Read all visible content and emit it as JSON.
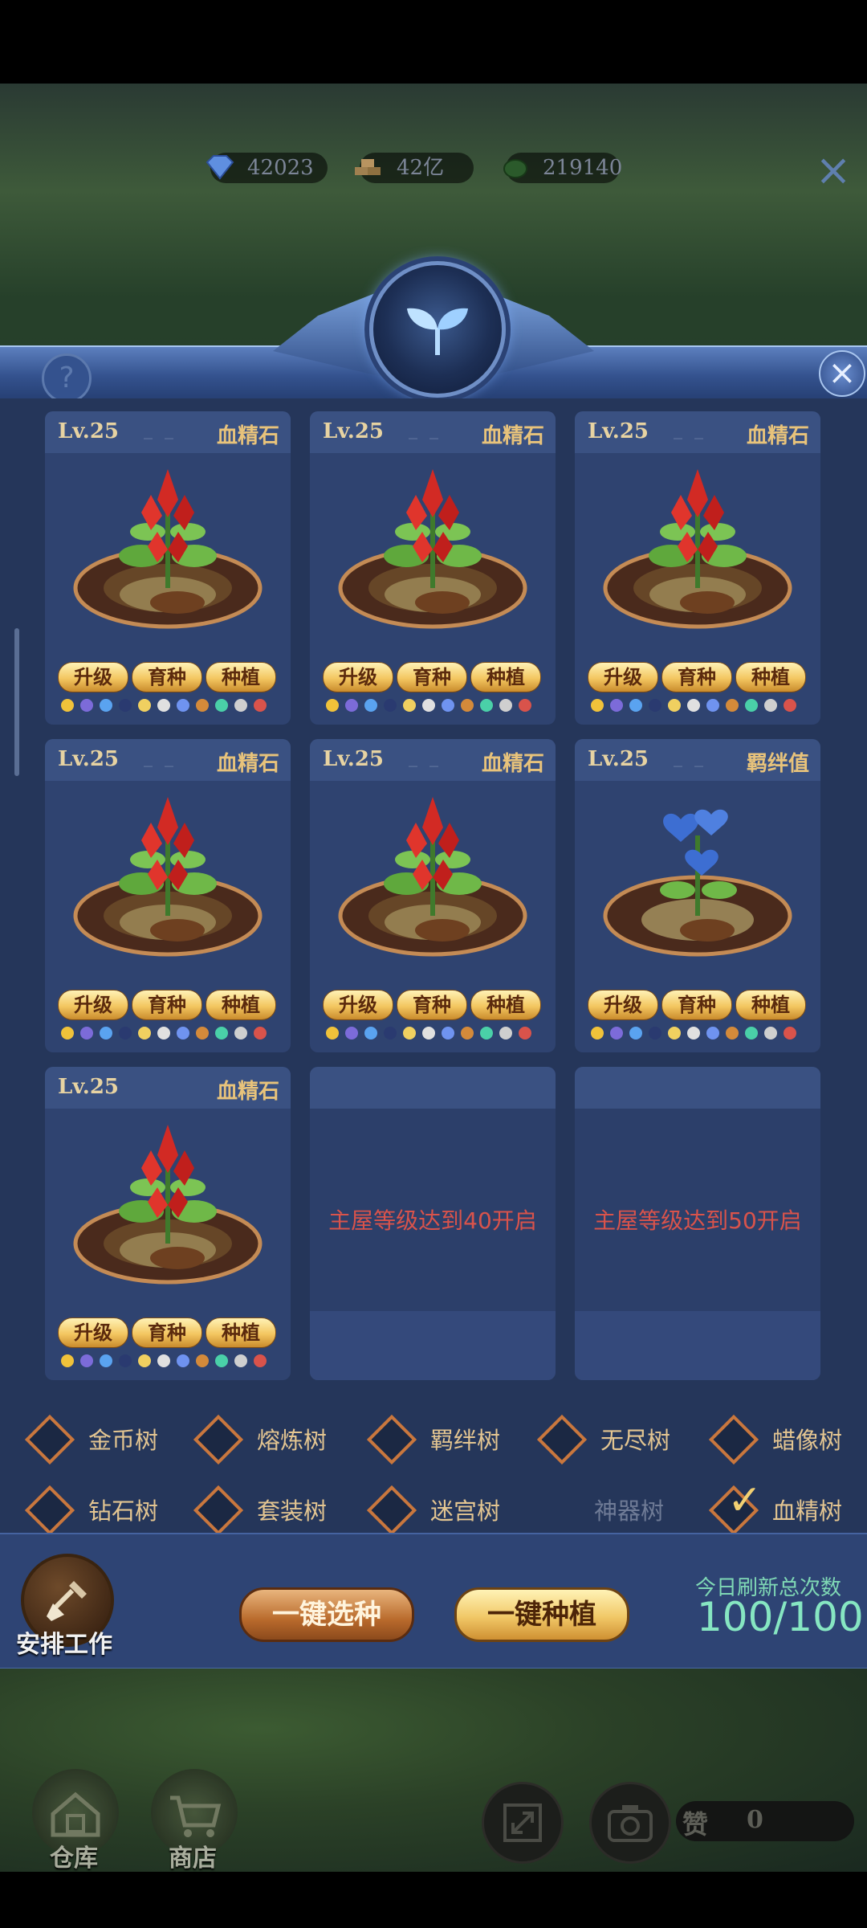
{
  "resources": [
    {
      "name": "diamond",
      "value": "42023"
    },
    {
      "name": "gold",
      "value": "42亿"
    },
    {
      "name": "essence",
      "value": "219140"
    }
  ],
  "panel": {
    "help_icon": "question-icon",
    "close_icon": "close-icon",
    "emblem_icon": "sprout-icon"
  },
  "card_buttons": {
    "upgrade": "升级",
    "breed": "育种",
    "plant": "种植"
  },
  "cards": [
    {
      "level": "Lv.25",
      "dash": "_ _",
      "type": "血精石",
      "plant": "red-crystal-plant"
    },
    {
      "level": "Lv.25",
      "dash": "_ _",
      "type": "血精石",
      "plant": "red-crystal-plant"
    },
    {
      "level": "Lv.25",
      "dash": "_ _",
      "type": "血精石",
      "plant": "red-crystal-plant"
    },
    {
      "level": "Lv.25",
      "dash": "_ _",
      "type": "血精石",
      "plant": "red-crystal-plant"
    },
    {
      "level": "Lv.25",
      "dash": "_ _",
      "type": "血精石",
      "plant": "red-crystal-plant"
    },
    {
      "level": "Lv.25",
      "dash": "_ _",
      "type": "羁绊值",
      "plant": "blue-heart-plant"
    },
    {
      "level": "Lv.25",
      "dash": "",
      "type": "血精石",
      "plant": "red-crystal-plant"
    }
  ],
  "locked": [
    {
      "text": "主屋等级达到40开启"
    },
    {
      "text": "主屋等级达到50开启"
    }
  ],
  "filters": [
    {
      "label": "金币树",
      "checked": false,
      "enabled": true
    },
    {
      "label": "熔炼树",
      "checked": false,
      "enabled": true
    },
    {
      "label": "羁绊树",
      "checked": false,
      "enabled": true
    },
    {
      "label": "无尽树",
      "checked": false,
      "enabled": true
    },
    {
      "label": "蜡像树",
      "checked": false,
      "enabled": true
    },
    {
      "label": "钻石树",
      "checked": false,
      "enabled": true
    },
    {
      "label": "套装树",
      "checked": false,
      "enabled": true
    },
    {
      "label": "迷宫树",
      "checked": false,
      "enabled": true
    },
    {
      "label": "神器树",
      "checked": false,
      "enabled": false
    },
    {
      "label": "血精树",
      "checked": true,
      "enabled": true
    }
  ],
  "bottom": {
    "arrange_label": "安排工作",
    "select_label": "一键选种",
    "plant_label": "一键种植",
    "refresh_label": "今日刷新总次数",
    "refresh_value": "100/100"
  },
  "dock": {
    "warehouse_label": "仓库",
    "shop_label": "商店",
    "like_label": "赞",
    "like_count": "0"
  },
  "colors": {
    "accent_gold": "#f1c867",
    "locked_red": "#d9534b",
    "panel_bg": "#25365a",
    "refresh_green": "#86e6c2"
  }
}
